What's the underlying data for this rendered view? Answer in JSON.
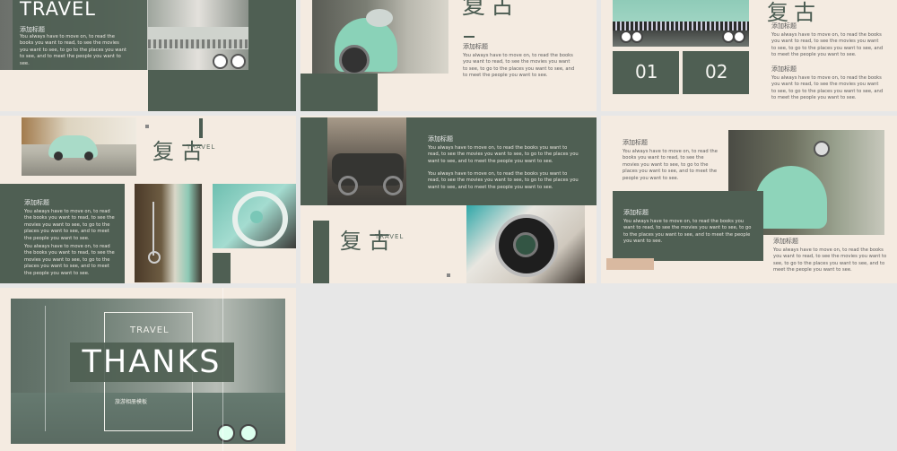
{
  "s1": {
    "title": "TRAVEL",
    "heading": "添加标题",
    "body": "You always have  to move on, to read the books you want to read, to see the movies you want to see, to go to the places you want to see, and to meet the people you want to see."
  },
  "s2": {
    "cn_title": "复古",
    "heading": "添加标题",
    "body": "You always have  to move on, to read the books you want to read, to see the movies you want to see, to go to the places you want to see, and to meet the people you want to see."
  },
  "s3": {
    "cn_title": "复古",
    "num1": "01",
    "num2": "02",
    "heading1": "添加标题",
    "body1": "You always have  to move on, to read the books you want to read, to see the movies you want to see, to go to the places you want to see, and to meet the people you want to see.",
    "heading2": "添加标题",
    "body2": "You always have  to move on, to read the books you want to read, to see the movies you want to see, to go to the places you want to see, and to meet the people you want to see."
  },
  "s4": {
    "cn_title": "复古",
    "travel": "TRAVEL",
    "heading": "添加标题",
    "body1": "You always have  to move on, to read the books you want to read, to see the movies you want to see, to go to the places you want to see, and to meet the people you want to see.",
    "body2": "You always have  to move on, to read the books you want to read, to see the movies you want to see, to go to the places you want to see, and to meet the people you want to see."
  },
  "s5": {
    "heading": "添加标题",
    "body1": "You always have  to move on, to read the books you want to read, to see the movies you want to see, to go to the places you want to see, and to meet the people you want to see.",
    "body2": "You always have  to move on, to read the books you want to read, to see the movies you want to see, to go to the places you want to see, and to meet the people you want to see.",
    "cn_title": "复古",
    "travel": "TRAVEL"
  },
  "s6": {
    "heading1": "添加标题",
    "body1": "You always have  to move on, to read the books you want to read, to see the movies you want to see, to go to the places you want to see, and to meet the people you want to see.",
    "heading2": "添加标题",
    "body2": "You always have  to move on, to read the books you want to read, to see the movies you want to see, to go to the places you want to see, and to meet the people you want to see.",
    "heading3": "添加标题",
    "body3": "You always have  to move on, to read the books you want to read, to see the movies you want to see, to go to the places you want to see, and to meet the people you want to see."
  },
  "s7": {
    "travel": "TRAVEL",
    "thanks": "THANKS",
    "subtitle": "旅游相册模板"
  },
  "colors": {
    "accent": "#4f5f53",
    "cream": "#f4ebe1",
    "tan": "#d9b9a0",
    "mint": "#7fc4a8"
  }
}
